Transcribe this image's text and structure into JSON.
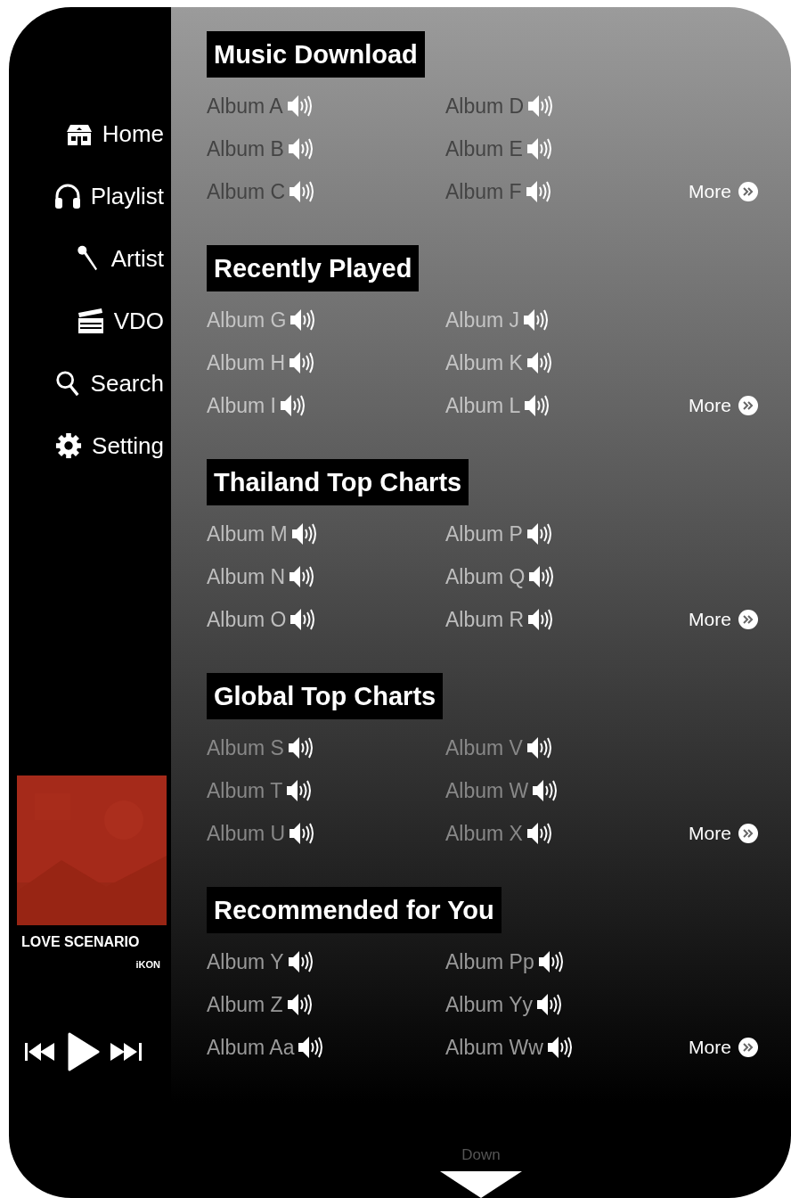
{
  "sidebar": {
    "items": [
      {
        "label": "Home",
        "kind": "home"
      },
      {
        "label": "Playlist",
        "kind": "playlist"
      },
      {
        "label": "Artist",
        "kind": "artist"
      },
      {
        "label": "VDO",
        "kind": "video"
      },
      {
        "label": "Search",
        "kind": "search"
      },
      {
        "label": "Setting",
        "kind": "setting"
      }
    ]
  },
  "now_playing": {
    "title": "LOVE SCENARIO",
    "artist": "iKON"
  },
  "sections": [
    {
      "title": "Music Download",
      "albums": [
        "Album A",
        "Album B",
        "Album C",
        "Album D",
        "Album E",
        "Album F"
      ],
      "more": "More"
    },
    {
      "title": "Recently Played",
      "albums": [
        "Album G",
        "Album H",
        "Album I",
        "Album J",
        "Album K",
        "Album L"
      ],
      "more": "More"
    },
    {
      "title": "Thailand Top Charts",
      "albums": [
        "Album M",
        "Album N",
        "Album O",
        "Album P",
        "Album Q",
        "Album R"
      ],
      "more": "More"
    },
    {
      "title": "Global Top Charts",
      "albums": [
        "Album S",
        "Album T",
        "Album U",
        "Album V",
        "Album W",
        "Album X"
      ],
      "more": "More"
    },
    {
      "title": "Recommended for You",
      "albums": [
        "Album Y",
        "Album Z",
        "Album Aa",
        "Album Pp",
        "Album Yy",
        "Album Ww"
      ],
      "more": "More"
    }
  ],
  "footer": {
    "label": "Down"
  }
}
